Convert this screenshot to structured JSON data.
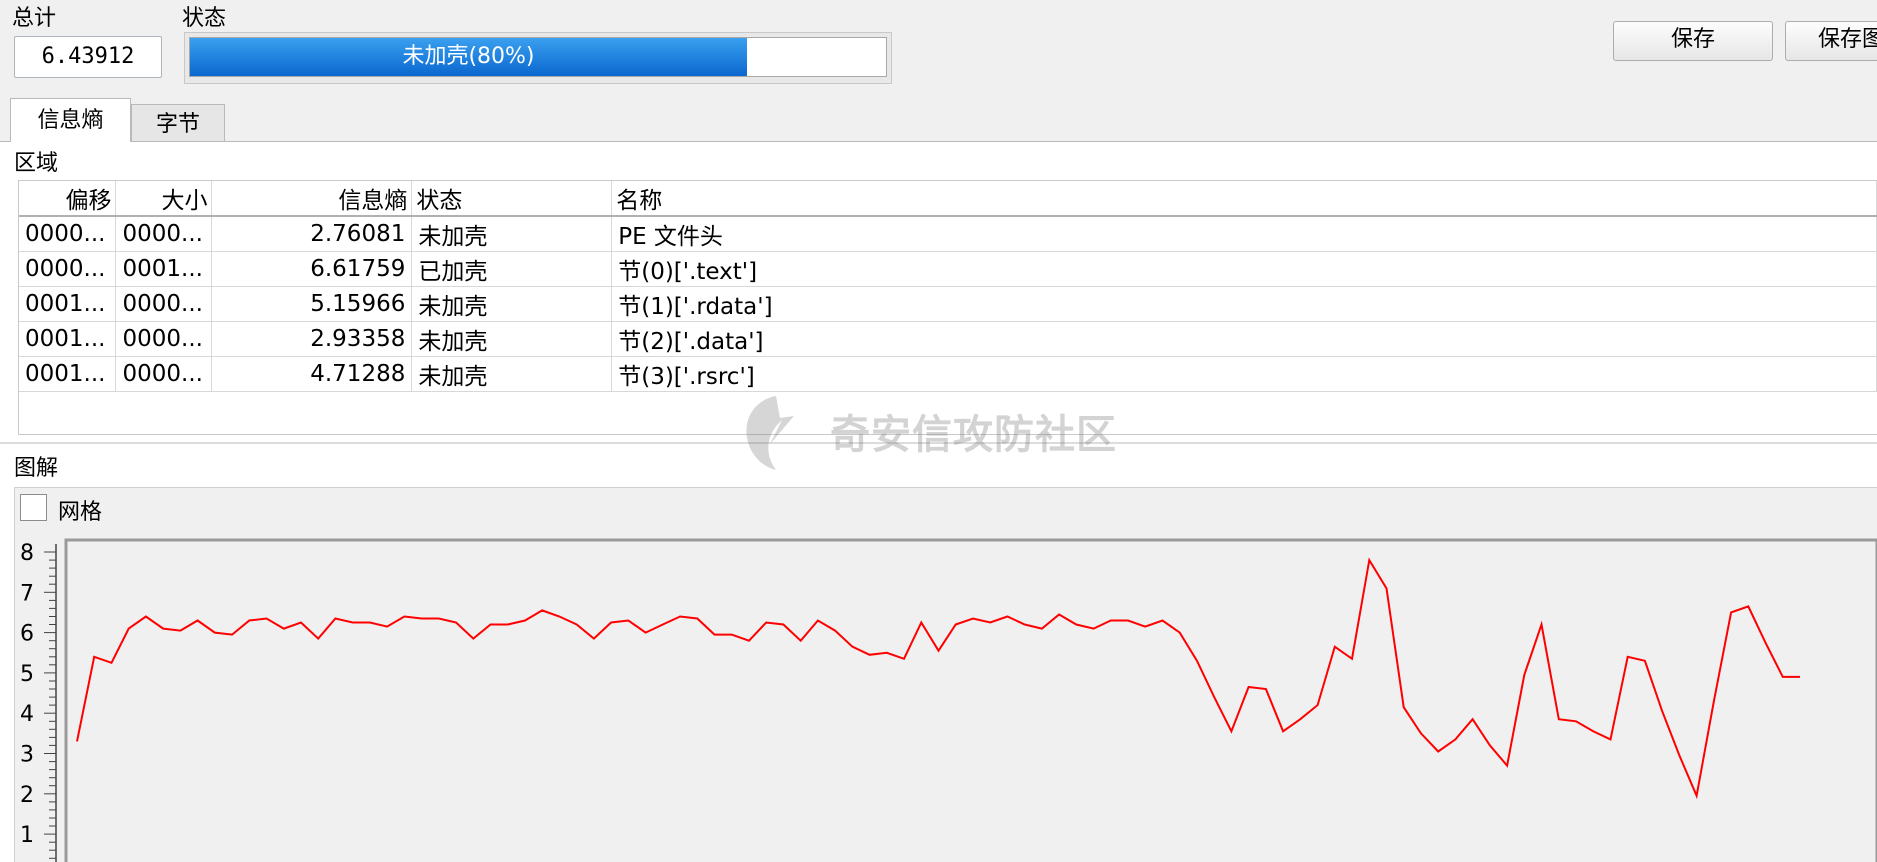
{
  "summary": {
    "total_label": "总计",
    "total_value": "6.43912",
    "status_label": "状态",
    "status_text": "未加壳(80%)",
    "status_progress": 0.8
  },
  "buttons": {
    "save": "保存",
    "save_image": "保存图"
  },
  "tabs": [
    {
      "label": "信息熵",
      "active": true
    },
    {
      "label": "字节",
      "active": false
    }
  ],
  "regions": {
    "label": "区域",
    "columns": [
      "偏移",
      "大小",
      "信息熵",
      "状态",
      "名称"
    ],
    "rows": [
      {
        "offset": "0000...",
        "size": "0000...",
        "entropy": "2.76081",
        "status": "未加壳",
        "name": "PE 文件头"
      },
      {
        "offset": "0000...",
        "size": "0001...",
        "entropy": "6.61759",
        "status": "已加壳",
        "name": "节(0)['.text']"
      },
      {
        "offset": "0001...",
        "size": "0000...",
        "entropy": "5.15966",
        "status": "未加壳",
        "name": "节(1)['.rdata']"
      },
      {
        "offset": "0001...",
        "size": "0000...",
        "entropy": "2.93358",
        "status": "未加壳",
        "name": "节(2)['.data']"
      },
      {
        "offset": "0001...",
        "size": "0000...",
        "entropy": "4.71288",
        "status": "未加壳",
        "name": "节(3)['.rsrc']"
      }
    ]
  },
  "diagram": {
    "label": "图解",
    "grid_label": "网格",
    "grid_checked": false
  },
  "watermark": "奇安信攻防社区",
  "chart_data": {
    "type": "line",
    "ylim": [
      0,
      8
    ],
    "y_ticks": [
      "1",
      "2",
      "3",
      "4",
      "5",
      "6",
      "7",
      "8"
    ],
    "grid": false,
    "line_color": "#ff0000",
    "series": [
      {
        "values": [
          3.3,
          5.4,
          5.25,
          6.1,
          6.4,
          6.1,
          6.05,
          6.3,
          6.0,
          5.95,
          6.3,
          6.35,
          6.1,
          6.25,
          5.85,
          6.35,
          6.25,
          6.25,
          6.15,
          6.4,
          6.35,
          6.35,
          6.25,
          5.85,
          6.2,
          6.2,
          6.3,
          6.55,
          6.4,
          6.2,
          5.85,
          6.25,
          6.3,
          6.0,
          6.2,
          6.4,
          6.35,
          5.95,
          5.95,
          5.8,
          6.25,
          6.2,
          5.8,
          6.3,
          6.05,
          5.65,
          5.45,
          5.5,
          5.35,
          6.25,
          5.55,
          6.2,
          6.35,
          6.25,
          6.4,
          6.2,
          6.1,
          6.45,
          6.2,
          6.1,
          6.3,
          6.3,
          6.15,
          6.3,
          6.0,
          5.3,
          4.4,
          3.55,
          4.65,
          4.6,
          3.55,
          3.85,
          4.2,
          5.65,
          5.35,
          7.8,
          7.1,
          4.15,
          3.5,
          3.05,
          3.35,
          3.85,
          3.2,
          2.7,
          4.95,
          6.2,
          3.85,
          3.8,
          3.55,
          3.35,
          5.4,
          5.3,
          4.05,
          2.95,
          1.95,
          4.3,
          6.5,
          6.65,
          5.75,
          4.9,
          4.9
        ]
      }
    ]
  }
}
